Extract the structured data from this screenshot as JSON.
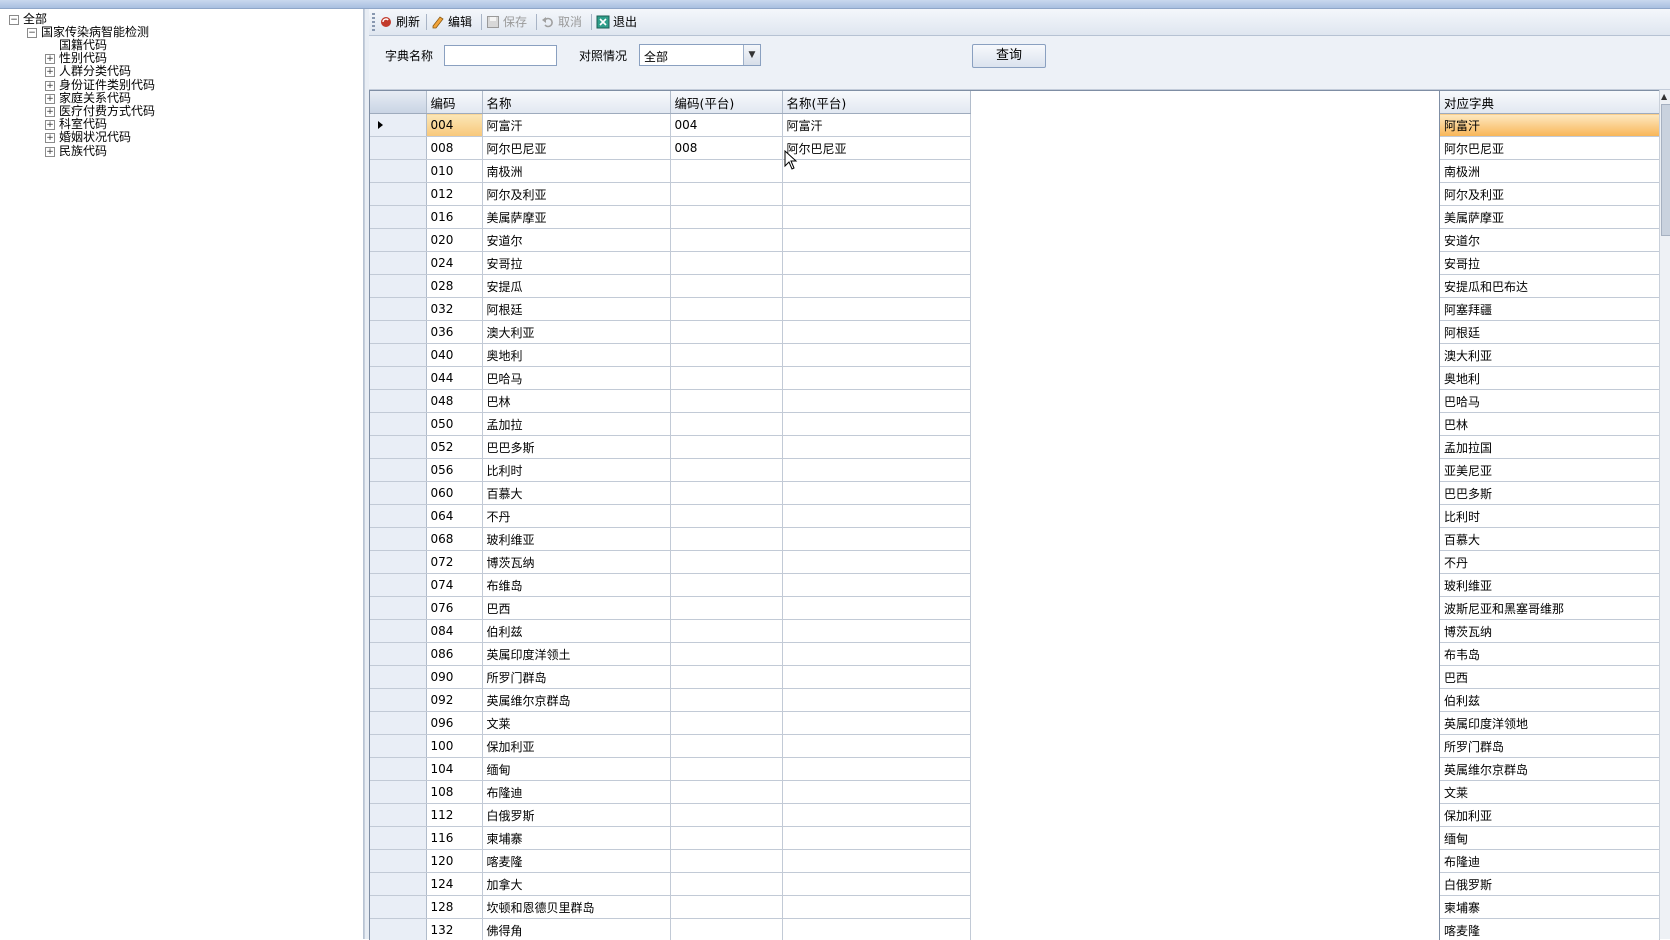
{
  "tree": {
    "root": "全部",
    "group": "国家传染病智能检测",
    "items": [
      "国籍代码",
      "性别代码",
      "人群分类代码",
      "身份证件类别代码",
      "家庭关系代码",
      "医疗付费方式代码",
      "科室代码",
      "婚姻状况代码",
      "民族代码"
    ]
  },
  "toolbar": {
    "refresh": "刷新",
    "edit": "编辑",
    "save": "保存",
    "cancel": "取消",
    "exit": "退出"
  },
  "filter": {
    "dict_name_label": "字典名称",
    "dict_name_value": "",
    "mapping_label": "对照情况",
    "mapping_value": "全部",
    "query_button": "查询"
  },
  "grid": {
    "columns": [
      "编码",
      "名称",
      "编码(平台)",
      "名称(平台)"
    ],
    "rows": [
      [
        "004",
        "阿富汗",
        "004",
        "阿富汗"
      ],
      [
        "008",
        "阿尔巴尼亚",
        "008",
        "阿尔巴尼亚"
      ],
      [
        "010",
        "南极洲",
        "",
        ""
      ],
      [
        "012",
        "阿尔及利亚",
        "",
        ""
      ],
      [
        "016",
        "美属萨摩亚",
        "",
        ""
      ],
      [
        "020",
        "安道尔",
        "",
        ""
      ],
      [
        "024",
        "安哥拉",
        "",
        ""
      ],
      [
        "028",
        "安提瓜",
        "",
        ""
      ],
      [
        "032",
        "阿根廷",
        "",
        ""
      ],
      [
        "036",
        "澳大利亚",
        "",
        ""
      ],
      [
        "040",
        "奥地利",
        "",
        ""
      ],
      [
        "044",
        "巴哈马",
        "",
        ""
      ],
      [
        "048",
        "巴林",
        "",
        ""
      ],
      [
        "050",
        "孟加拉",
        "",
        ""
      ],
      [
        "052",
        "巴巴多斯",
        "",
        ""
      ],
      [
        "056",
        "比利时",
        "",
        ""
      ],
      [
        "060",
        "百慕大",
        "",
        ""
      ],
      [
        "064",
        "不丹",
        "",
        ""
      ],
      [
        "068",
        "玻利维亚",
        "",
        ""
      ],
      [
        "072",
        "博茨瓦纳",
        "",
        ""
      ],
      [
        "074",
        "布维岛",
        "",
        ""
      ],
      [
        "076",
        "巴西",
        "",
        ""
      ],
      [
        "084",
        "伯利兹",
        "",
        ""
      ],
      [
        "086",
        "英属印度洋领土",
        "",
        ""
      ],
      [
        "090",
        "所罗门群岛",
        "",
        ""
      ],
      [
        "092",
        "英属维尔京群岛",
        "",
        ""
      ],
      [
        "096",
        "文莱",
        "",
        ""
      ],
      [
        "100",
        "保加利亚",
        "",
        ""
      ],
      [
        "104",
        "缅甸",
        "",
        ""
      ],
      [
        "108",
        "布隆迪",
        "",
        ""
      ],
      [
        "112",
        "白俄罗斯",
        "",
        ""
      ],
      [
        "116",
        "柬埔寨",
        "",
        ""
      ],
      [
        "120",
        "喀麦隆",
        "",
        ""
      ],
      [
        "124",
        "加拿大",
        "",
        ""
      ],
      [
        "128",
        "坎顿和恩德贝里群岛",
        "",
        ""
      ],
      [
        "132",
        "佛得角",
        "",
        ""
      ]
    ]
  },
  "dict": {
    "header": "对应字典",
    "items": [
      "阿富汗",
      "阿尔巴尼亚",
      "南极洲",
      "阿尔及利亚",
      "美属萨摩亚",
      "安道尔",
      "安哥拉",
      "安提瓜和巴布达",
      "阿塞拜疆",
      "阿根廷",
      "澳大利亚",
      "奥地利",
      "巴哈马",
      "巴林",
      "孟加拉国",
      "亚美尼亚",
      "巴巴多斯",
      "比利时",
      "百慕大",
      "不丹",
      "玻利维亚",
      "波斯尼亚和黑塞哥维那",
      "博茨瓦纳",
      "布韦岛",
      "巴西",
      "伯利兹",
      "英属印度洋领地",
      "所罗门群岛",
      "英属维尔京群岛",
      "文莱",
      "保加利亚",
      "缅甸",
      "布隆迪",
      "白俄罗斯",
      "柬埔寨",
      "喀麦隆"
    ]
  },
  "colors": {
    "selection": "#f8c77a",
    "header_bg": "#e2e8f1",
    "row_header_bg": "#e9eef6"
  }
}
